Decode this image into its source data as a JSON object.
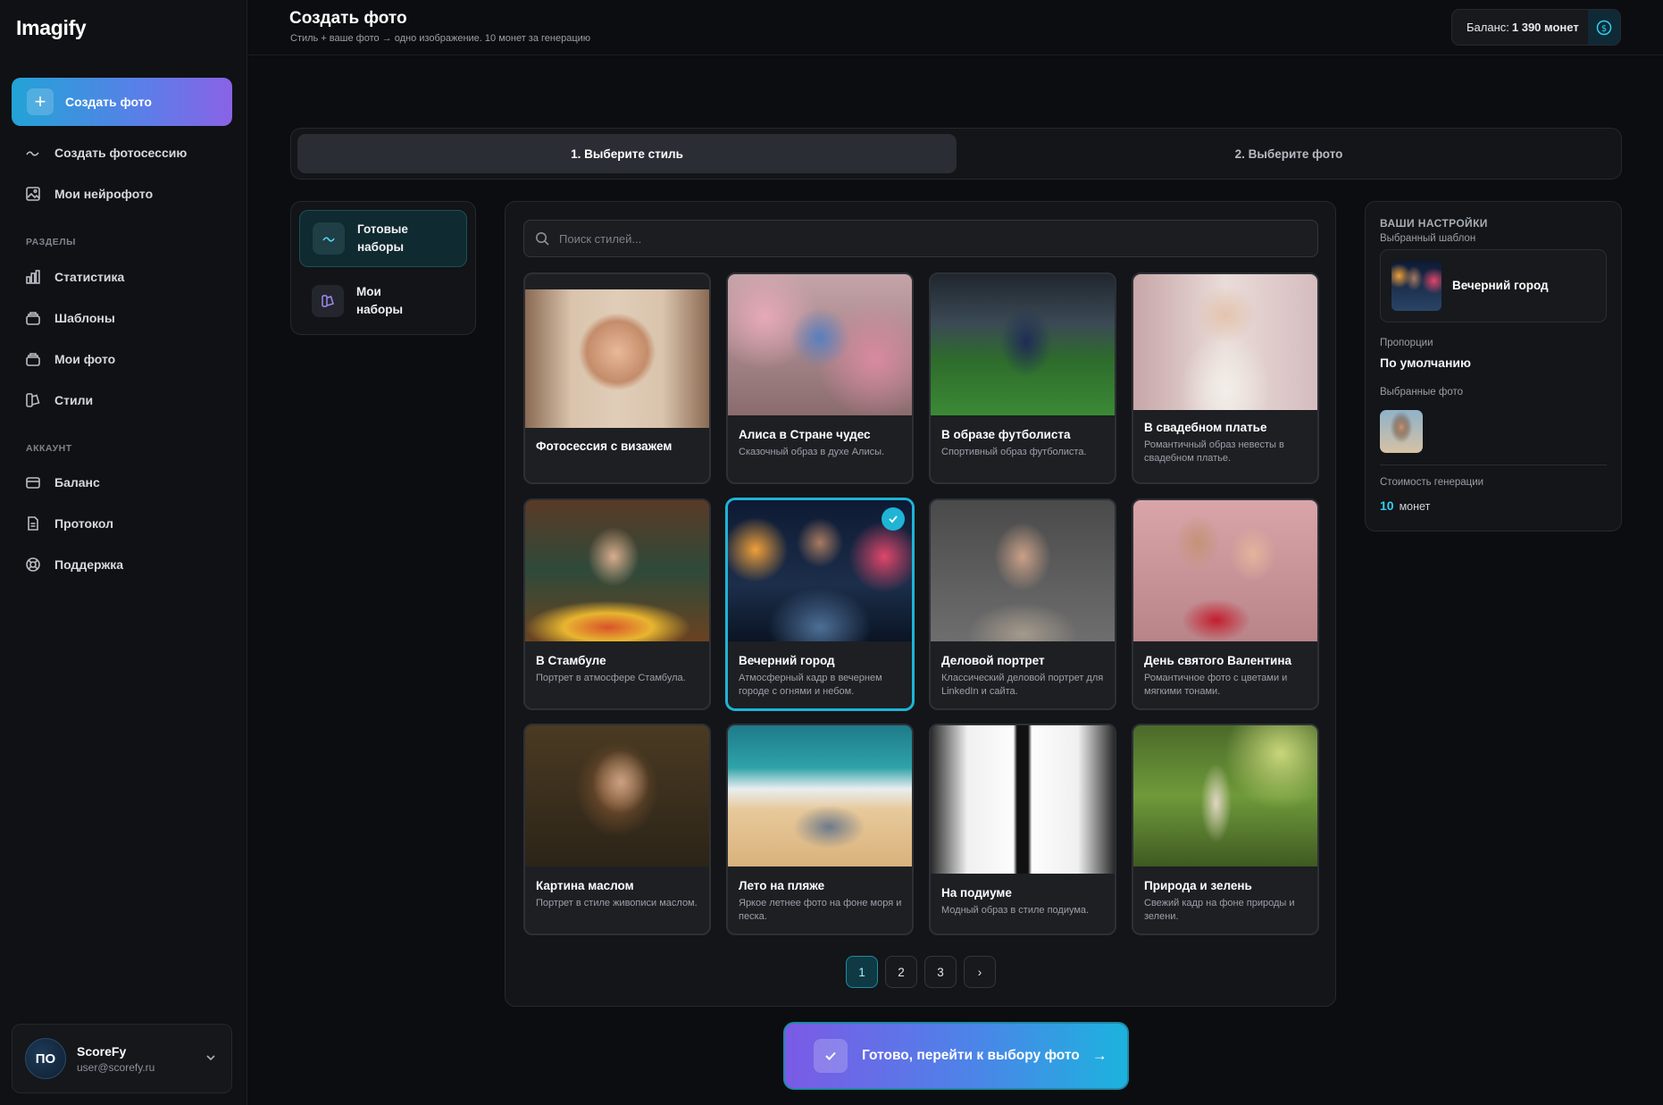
{
  "app": {
    "name": "Imagify"
  },
  "sidebar": {
    "create_button": "Создать фото",
    "items_top": [
      {
        "label": "Создать фотосессию",
        "icon": "wave-icon"
      },
      {
        "label": "Мои нейрофото",
        "icon": "image-icon"
      }
    ],
    "section_sections": "РАЗДЕЛЫ",
    "items_sections": [
      {
        "label": "Статистика",
        "icon": "chart-icon"
      },
      {
        "label": "Шаблоны",
        "icon": "stack-icon"
      },
      {
        "label": "Мои фото",
        "icon": "stack-icon"
      },
      {
        "label": "Стили",
        "icon": "palette-icon"
      }
    ],
    "section_account": "АККАУНТ",
    "items_account": [
      {
        "label": "Баланс",
        "icon": "wallet-icon"
      },
      {
        "label": "Протокол",
        "icon": "document-icon"
      },
      {
        "label": "Поддержка",
        "icon": "lifebuoy-icon"
      }
    ],
    "user": {
      "initials": "ПО",
      "name": "ScoreFy",
      "email": "user@scorefy.ru"
    }
  },
  "header": {
    "title": "Создать фото",
    "subtitle": "Стиль + ваше фото → одно изображение. 10 монет за генерацию",
    "balance_label": "Баланс:",
    "balance_value": "1 390 монет"
  },
  "steps": {
    "step1": "1. Выберите стиль",
    "step2": "2. Выберите фото"
  },
  "sets": {
    "ready": "Готовые наборы",
    "mine": "Мои наборы"
  },
  "search": {
    "placeholder": "Поиск стилей..."
  },
  "styles": [
    {
      "title": "Фотосессия с визажем",
      "desc": "",
      "selected": false
    },
    {
      "title": "Алиса в Стране чудес",
      "desc": "Сказочный образ в духе Алисы.",
      "selected": false
    },
    {
      "title": "В образе футболиста",
      "desc": "Спортивный образ футболиста.",
      "selected": false
    },
    {
      "title": "В свадебном платье",
      "desc": "Романтичный образ невесты в свадебном платье.",
      "selected": false
    },
    {
      "title": "В Стамбуле",
      "desc": "Портрет в атмосфере Стамбула.",
      "selected": false
    },
    {
      "title": "Вечерний город",
      "desc": "Атмосферный кадр в вечернем городе с огнями и небом.",
      "selected": true
    },
    {
      "title": "Деловой портрет",
      "desc": "Классический деловой портрет для LinkedIn и сайта.",
      "selected": false
    },
    {
      "title": "День святого Валентина",
      "desc": "Романтичное фото с цветами и мягкими тонами.",
      "selected": false
    },
    {
      "title": "Картина маслом",
      "desc": "Портрет в стиле живописи маслом.",
      "selected": false
    },
    {
      "title": "Лето на пляже",
      "desc": "Яркое летнее фото на фоне моря и песка.",
      "selected": false
    },
    {
      "title": "На подиуме",
      "desc": "Модный образ в стиле подиума.",
      "selected": false
    },
    {
      "title": "Природа и зелень",
      "desc": "Свежий кадр на фоне природы и зелени.",
      "selected": false
    }
  ],
  "pagination": {
    "pages": [
      "1",
      "2",
      "3"
    ],
    "current": "1",
    "next": "›"
  },
  "settings": {
    "heading": "ВАШИ НАСТРОЙКИ",
    "template_label": "Выбранный шаблон",
    "template_name": "Вечерний город",
    "ratio_label": "Пропорции",
    "ratio_value": "По умолчанию",
    "photos_label": "Выбранные фото",
    "cost_label": "Стоимость генерации",
    "cost_value": "10",
    "cost_unit": "монет"
  },
  "continue_button": "Готово, перейти к выбору фото",
  "colors": {
    "accent": "#1fb4d6",
    "gradient_start": "#7b5ae6",
    "gradient_end": "#1cb3de"
  }
}
